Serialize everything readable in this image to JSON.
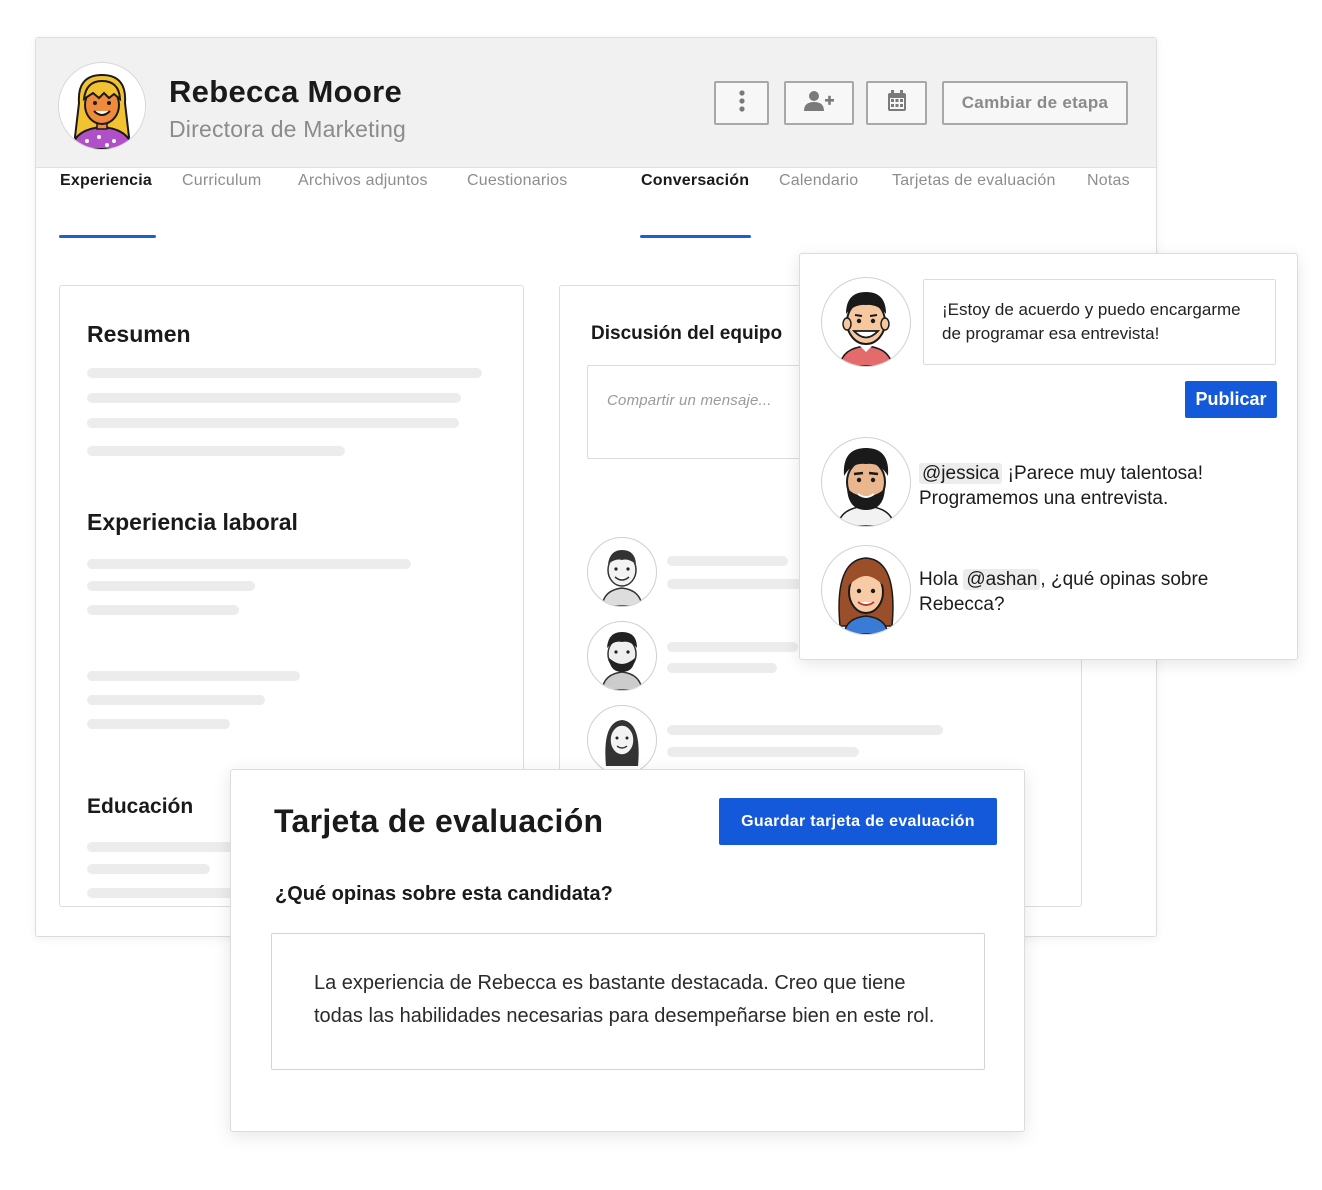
{
  "candidate": {
    "name": "Rebecca Moore",
    "role": "Directora de Marketing"
  },
  "header": {
    "more_icon": "vertical-dots-icon",
    "add_user_icon": "user-plus-icon",
    "calendar_icon": "calendar-icon",
    "change_stage_label": "Cambiar de etapa"
  },
  "left_tabs": [
    {
      "label": "Experiencia",
      "active": true
    },
    {
      "label": "Curriculum",
      "active": false
    },
    {
      "label": "Archivos adjuntos",
      "active": false
    },
    {
      "label": "Cuestionarios",
      "active": false
    }
  ],
  "right_tabs": [
    {
      "label": "Conversación",
      "active": true
    },
    {
      "label": "Calendario",
      "active": false
    },
    {
      "label": "Tarjetas de evaluación",
      "active": false
    },
    {
      "label": "Notas",
      "active": false
    }
  ],
  "profile": {
    "summary_title": "Resumen",
    "experience_title": "Experiencia laboral",
    "education_title": "Educación"
  },
  "team": {
    "title": "Discusión del equipo",
    "placeholder": "Compartir un mensaje..."
  },
  "conversation": {
    "reply_text": "¡Estoy de acuerdo y puedo encargarme de programar esa entrevista!",
    "publish_label": "Publicar",
    "comments": [
      {
        "mention": "@jessica",
        "before": "",
        "after": " ¡Parece muy talentosa! Programemos una entrevista."
      },
      {
        "mention": "@ashan",
        "before": "Hola ",
        "after": ", ¿qué opinas sobre Rebecca?"
      }
    ]
  },
  "scorecard": {
    "title": "Tarjeta de evaluación",
    "save_label": "Guardar tarjeta de evaluación",
    "question": "¿Qué opinas sobre esta candidata?",
    "answer": "La experiencia de Rebecca es bastante destacada. Creo que tiene todas las habilidades necesarias para desempeñarse bien en este rol."
  },
  "colors": {
    "accent": "#1459d9",
    "tab_underline": "#1a5fd8",
    "header_bg": "#f1f1f2"
  }
}
